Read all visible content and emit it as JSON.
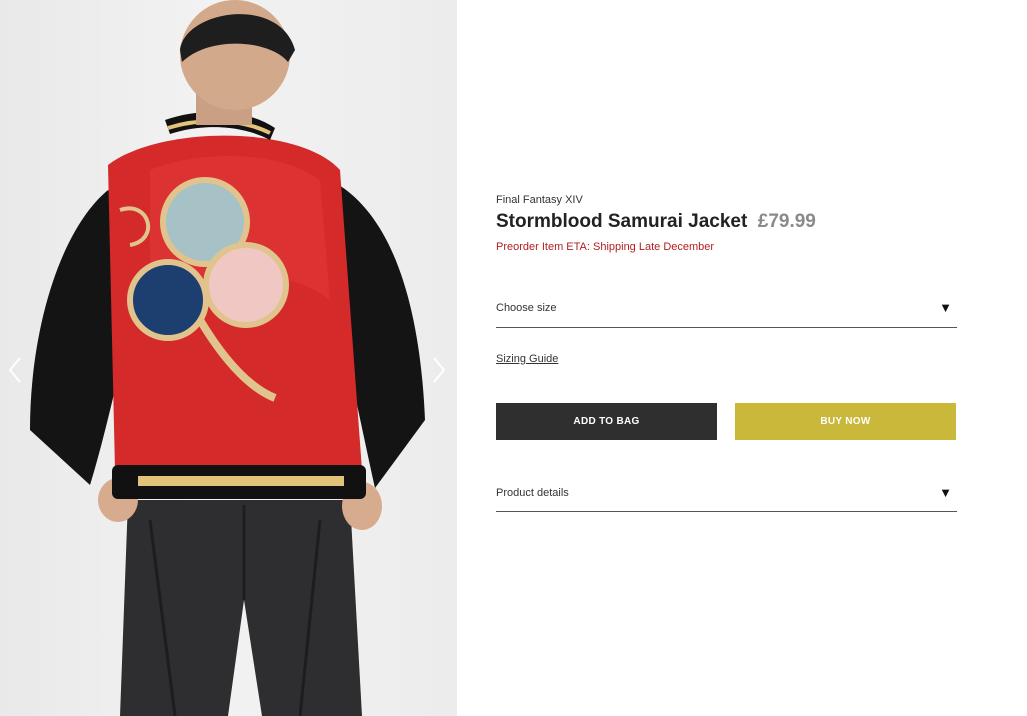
{
  "product": {
    "brand": "Final Fantasy XIV",
    "title": "Stormblood Samurai Jacket",
    "price": "£79.99",
    "preorder_note": "Preorder Item ETA: Shipping Late December"
  },
  "size_select": {
    "label": "Choose size",
    "caret": "▼"
  },
  "sizing_guide": "Sizing Guide",
  "buttons": {
    "add_to_bag": "ADD TO BAG",
    "buy_now": "BUY NOW"
  },
  "product_details": {
    "label": "Product details",
    "caret": "▼"
  },
  "gallery": {
    "prev_icon": "chevron-left-icon",
    "next_icon": "chevron-right-icon"
  },
  "colors": {
    "preorder": "#b01f1f",
    "buy_now": "#c9b83a",
    "add_to_bag": "#2f2f2f",
    "price": "#8a8a8a"
  }
}
